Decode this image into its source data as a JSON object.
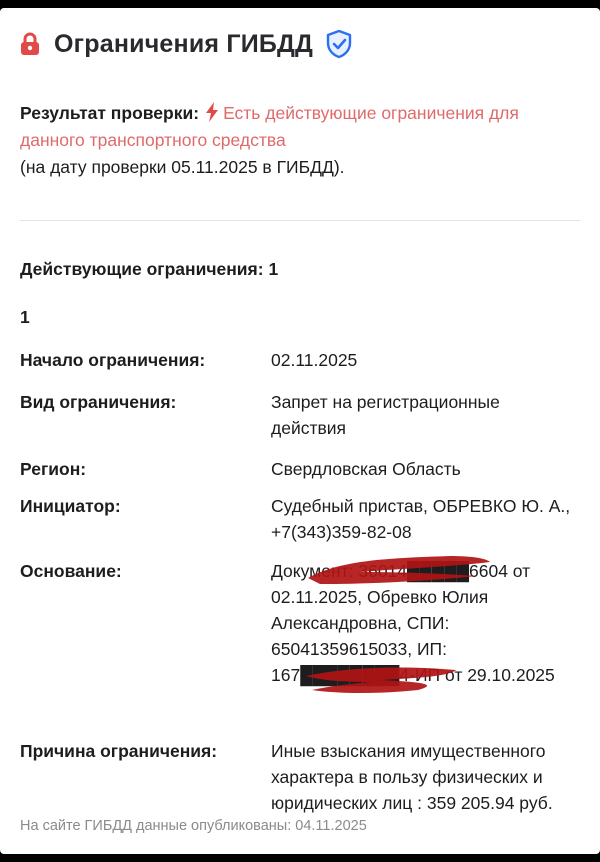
{
  "header": {
    "title": "Ограничения ГИБДД",
    "lock_icon": "lock-icon",
    "shield_icon": "shield-check-icon",
    "accent_color": "#e24a4a",
    "shield_color": "#2b6ef0"
  },
  "result": {
    "label": "Результат проверки:",
    "status": "Есть действующие ограничения для данного транспортного средства",
    "date_note": "(на дату проверки 05.11.2025 в ГИБДД).",
    "status_color": "#e06a6a",
    "icon": "lightning-icon"
  },
  "restrictions": {
    "count_label": "Действующие ограничения: 1",
    "items": [
      {
        "index": "1",
        "fields": [
          {
            "key": "Начало ограничения:",
            "value": "02.11.2025"
          },
          {
            "key": "Вид ограничения:",
            "value": "Запрет на регистрационные действия"
          },
          {
            "key": "Регион:",
            "value": "Свердловская Область"
          },
          {
            "key": "Инициатор:",
            "value": "Судебный пристав, ОБРЕВКО Ю. А., +7(343)359-82-08"
          },
          {
            "key": "Основание:",
            "value": "Документ: 36014█████6604 от 02.11.2025, Обревко Юлия Александровна, СПИ: 65041359615033, ИП: 167████████4-ИП от 29.10.2025"
          },
          {
            "key": "Причина ограничения:",
            "value": "Иные взыскания имущественного характера в пользу физических и юридических лиц : 359 205.94 руб."
          }
        ]
      }
    ]
  },
  "footer": {
    "published": "На сайте ГИБДД данные опубликованы: 04.11.2025"
  }
}
